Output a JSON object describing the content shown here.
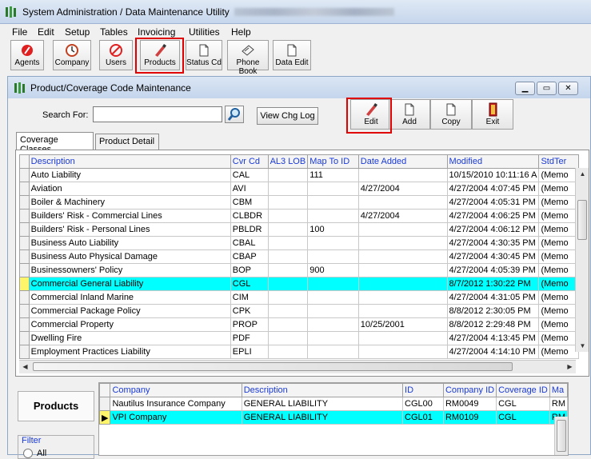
{
  "window": {
    "title": "System Administration / Data Maintenance Utility"
  },
  "menu": [
    "File",
    "Edit",
    "Setup",
    "Tables",
    "Invoicing",
    "Utilities",
    "Help"
  ],
  "toolbar": [
    {
      "label": "Agents",
      "icon": "agents-icon"
    },
    {
      "label": "Company",
      "icon": "company-icon"
    },
    {
      "label": "Users",
      "icon": "users-icon"
    },
    {
      "label": "Products",
      "icon": "products-icon"
    },
    {
      "label": "Status Cd",
      "icon": "status-icon"
    },
    {
      "label": "Phone Book",
      "icon": "phone-book-icon"
    },
    {
      "label": "Data Edit",
      "icon": "data-edit-icon"
    }
  ],
  "child": {
    "title": "Product/Coverage Code Maintenance",
    "search_label": "Search For:",
    "search_value": "",
    "view_log_label": "View Chg Log",
    "actions": [
      "Edit",
      "Add",
      "Copy",
      "Exit"
    ],
    "tabs": [
      "Coverage Classes",
      "Product Detail"
    ]
  },
  "grid": {
    "columns": [
      "Description",
      "Cvr Cd",
      "AL3 LOB",
      "Map To ID",
      "Date Added",
      "Modified",
      "StdTer"
    ],
    "rows": [
      [
        "Auto Liability",
        "CAL",
        "",
        "111",
        "",
        "10/15/2010 10:11:16 A",
        "(Memo"
      ],
      [
        "Aviation",
        "AVI",
        "",
        "",
        "4/27/2004",
        "4/27/2004 4:07:45 PM",
        "(Memo"
      ],
      [
        "Boiler & Machinery",
        "CBM",
        "",
        "",
        "",
        "4/27/2004 4:05:31 PM",
        "(Memo"
      ],
      [
        "Builders' Risk - Commercial Lines",
        "CLBDR",
        "",
        "",
        "4/27/2004",
        "4/27/2004 4:06:25 PM",
        "(Memo"
      ],
      [
        "Builders' Risk - Personal Lines",
        "PBLDR",
        "",
        "100",
        "",
        "4/27/2004 4:06:12 PM",
        "(Memo"
      ],
      [
        "Business Auto Liability",
        "CBAL",
        "",
        "",
        "",
        "4/27/2004 4:30:35 PM",
        "(Memo"
      ],
      [
        "Business Auto Physical Damage",
        "CBAP",
        "",
        "",
        "",
        "4/27/2004 4:30:45 PM",
        "(Memo"
      ],
      [
        "Businessowners' Policy",
        "BOP",
        "",
        "900",
        "",
        "4/27/2004 4:05:39 PM",
        "(Memo"
      ],
      [
        "Commercial General Liability",
        "CGL",
        "",
        "",
        "",
        "8/7/2012 1:30:22 PM",
        "(Memo"
      ],
      [
        "Commercial Inland Marine",
        "CIM",
        "",
        "",
        "",
        "4/27/2004 4:31:05 PM",
        "(Memo"
      ],
      [
        "Commercial Package Policy",
        "CPK",
        "",
        "",
        "",
        "8/8/2012 2:30:05 PM",
        "(Memo"
      ],
      [
        "Commercial Property",
        "PROP",
        "",
        "",
        "10/25/2001",
        "8/8/2012 2:29:48 PM",
        "(Memo"
      ],
      [
        "Dwelling Fire",
        "PDF",
        "",
        "",
        "",
        "4/27/2004 4:13:45 PM",
        "(Memo"
      ],
      [
        "Employment Practices Liability",
        "EPLI",
        "",
        "",
        "",
        "4/27/2004 4:14:10 PM",
        "(Memo"
      ]
    ],
    "selected_row": 8
  },
  "products": {
    "button_label": "Products",
    "filter_label": "Filter",
    "radio_all": "All",
    "columns": [
      "Company",
      "Description",
      "ID",
      "Company ID",
      "Coverage ID",
      "Ma"
    ],
    "rows": [
      [
        "Nautilus Insurance Company",
        "GENERAL LIABILITY",
        "CGL00",
        "RM0049",
        "CGL",
        "RM"
      ],
      [
        "VPI Company",
        "GENERAL LIABILITY",
        "CGL01",
        "RM0109",
        "CGL",
        "RM"
      ]
    ],
    "selected_row": 1
  },
  "colors": {
    "selection": "#00ffff",
    "header_text": "#1a3ad6",
    "highlight_box": "#e00000"
  }
}
